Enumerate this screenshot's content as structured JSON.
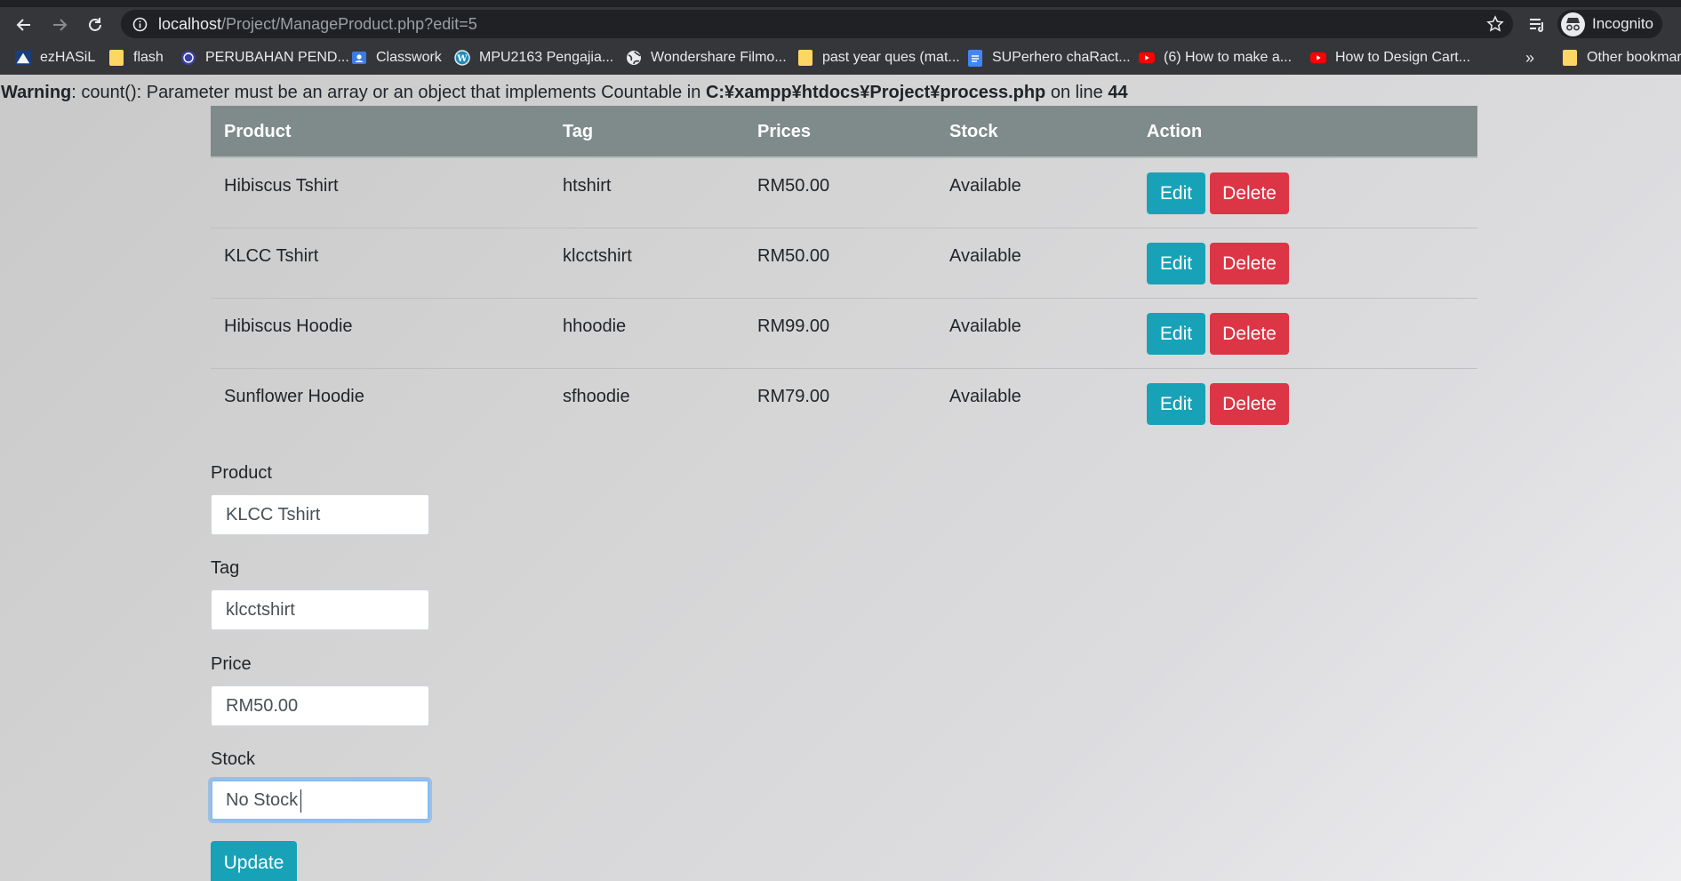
{
  "browser": {
    "url_host": "localhost",
    "url_path": "/Project/ManageProduct.php?edit=5",
    "profile_label": "Incognito",
    "bookmarks": [
      {
        "label": "ezHASiL",
        "icon": "ezhasil-icon"
      },
      {
        "label": "flash",
        "icon": "folder-icon"
      },
      {
        "label": "PERUBAHAN PEND...",
        "icon": "globe-seal-icon"
      },
      {
        "label": "Classwork",
        "icon": "classroom-icon"
      },
      {
        "label": "MPU2163 Pengajia...",
        "icon": "wordpress-icon"
      },
      {
        "label": "Wondershare Filmo...",
        "icon": "globe-icon"
      },
      {
        "label": "past year ques (mat...",
        "icon": "folder-icon"
      },
      {
        "label": "SUPerhero chaRact...",
        "icon": "google-docs-icon"
      },
      {
        "label": "(6) How to make a...",
        "icon": "youtube-icon"
      },
      {
        "label": "How to Design Cart...",
        "icon": "youtube-icon"
      }
    ],
    "overflow_label": "»",
    "other_bookmarks_label": "Other bookmarks"
  },
  "warning": {
    "prefix": "Warning",
    "message": ": count(): Parameter must be an array or an object that implements Countable in ",
    "file": "C:¥xampp¥htdocs¥Project¥process.php",
    "line_text": " on line ",
    "line_no": "44"
  },
  "table": {
    "headers": [
      "Product",
      "Tag",
      "Prices",
      "Stock",
      "Action"
    ],
    "rows": [
      {
        "product": "Hibiscus Tshirt",
        "tag": "htshirt",
        "price": "RM50.00",
        "stock": "Available"
      },
      {
        "product": "KLCC Tshirt",
        "tag": "klcctshirt",
        "price": "RM50.00",
        "stock": "Available"
      },
      {
        "product": "Hibiscus Hoodie",
        "tag": "hhoodie",
        "price": "RM99.00",
        "stock": "Available"
      },
      {
        "product": "Sunflower Hoodie",
        "tag": "sfhoodie",
        "price": "RM79.00",
        "stock": "Available"
      }
    ],
    "edit_label": "Edit",
    "delete_label": "Delete"
  },
  "form": {
    "product_label": "Product",
    "product_value": "KLCC Tshirt",
    "tag_label": "Tag",
    "tag_value": "klcctshirt",
    "price_label": "Price",
    "price_value": "RM50.00",
    "stock_label": "Stock",
    "stock_value": "No Stock",
    "update_label": "Update"
  },
  "colors": {
    "table_header": "#7e8b8a",
    "edit_button": "#17a2b8",
    "delete_button": "#dc3545",
    "update_button": "#17a2b8"
  }
}
